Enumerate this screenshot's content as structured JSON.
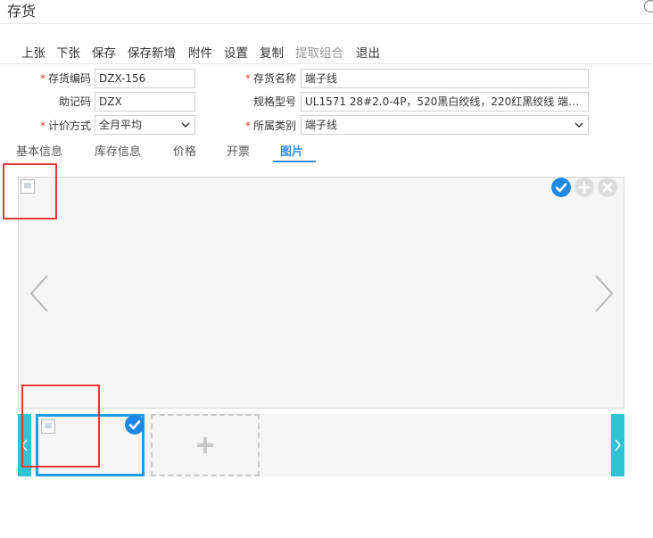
{
  "window": {
    "title": "存货"
  },
  "toolbar": {
    "items": [
      {
        "label": "上张",
        "enabled": true
      },
      {
        "label": "下张",
        "enabled": true
      },
      {
        "label": "保存",
        "enabled": true
      },
      {
        "label": "保存新增",
        "enabled": true
      },
      {
        "label": "附件",
        "enabled": true
      },
      {
        "label": "设置",
        "enabled": true
      },
      {
        "label": "复制",
        "enabled": true
      },
      {
        "label": "提取组合",
        "enabled": false
      },
      {
        "label": "退出",
        "enabled": true
      }
    ]
  },
  "form": {
    "code": {
      "label": "存货编码",
      "required": true,
      "value": "DZX-156"
    },
    "mnemonic": {
      "label": "助记码",
      "required": false,
      "value": "DZX"
    },
    "valuation": {
      "label": "计价方式",
      "required": true,
      "value": "全月平均"
    },
    "name": {
      "label": "存货名称",
      "required": true,
      "value": "端子线"
    },
    "spec": {
      "label": "规格型号",
      "required": false,
      "value": "UL1571 28#2.0-4P，520黑白绞线，220红黑绞线 端子黑..."
    },
    "category": {
      "label": "所属类别",
      "required": true,
      "value": "端子线"
    }
  },
  "tabs": [
    {
      "label": "基本信息",
      "active": false
    },
    {
      "label": "库存信息",
      "active": false
    },
    {
      "label": "价格",
      "active": false
    },
    {
      "label": "开票",
      "active": false
    },
    {
      "label": "图片",
      "active": true
    }
  ],
  "colors": {
    "accent": "#2f8ddf",
    "thumb_border": "#1e9be6",
    "strip_arrow": "#2ec4d6",
    "highlight": "#e53935",
    "required": "#e53935"
  },
  "icons": {
    "viewer_prev": "chevron-left-icon",
    "viewer_next": "chevron-right-icon",
    "confirm": "check-circle-icon",
    "add": "plus-circle-icon",
    "delete": "x-circle-icon",
    "strip_prev": "chevron-left-icon",
    "strip_next": "chevron-right-icon",
    "add_image": "plus-icon",
    "window_close": "close-icon"
  }
}
